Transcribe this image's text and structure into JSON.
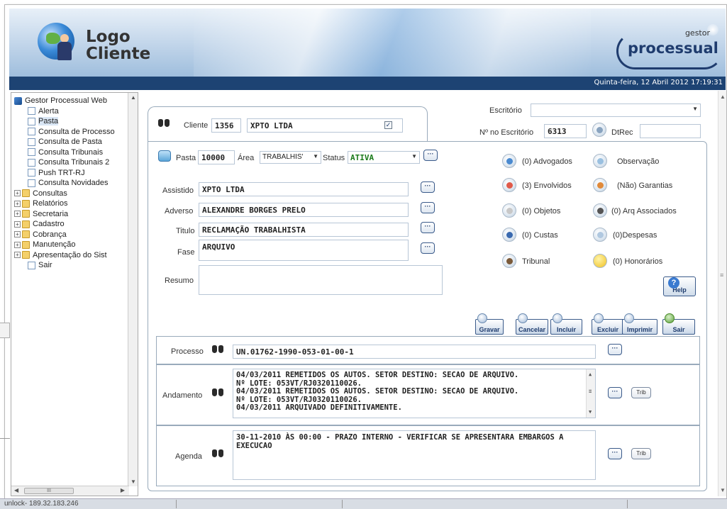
{
  "header": {
    "logo_line1": "Logo",
    "logo_line2": "Cliente",
    "brand_small": "gestor",
    "brand_big": "processual",
    "datetime": "Quinta-feira, 12 Abril 2012 17:19:31"
  },
  "sidebar": {
    "root": "Gestor Processual Web",
    "pages": [
      "Alerta",
      "Pasta",
      "Consulta de Processo",
      "Consulta de Pasta",
      "Consulta Tribunais",
      "Consulta Tribunais 2",
      "Push TRT-RJ",
      "Consulta Novidades"
    ],
    "selected": "Pasta",
    "groups": [
      "Consultas",
      "Relatórios",
      "Secretaria",
      "Cadastro",
      "Cobrança",
      "Manutenção",
      "Apresentação do Sist"
    ],
    "last": "Sair",
    "hscroll_label": "III"
  },
  "form": {
    "cliente_label": "Cliente",
    "cliente_code": "1356",
    "cliente_name": "XPTO LTDA",
    "cliente_check": "✓",
    "escritorio_label": "Escritório",
    "escritorio_value": "",
    "no_escritorio_label": "Nº no Escritório",
    "no_escritorio_value": "6313",
    "dtrec_label": "DtRec",
    "dtrec_value": "",
    "pasta_label": "Pasta",
    "pasta_value": "10000",
    "area_label": "Área",
    "area_value": "TRABALHIS'",
    "status_label": "Status",
    "status_value": "ATIVA",
    "assistido_label": "Assistido",
    "assistido_value": "XPTO LTDA",
    "adverso_label": "Adverso",
    "adverso_value": "ALEXANDRE BORGES PRELO",
    "titulo_label": "Titulo",
    "titulo_value": "RECLAMAÇÃO TRABALHISTA",
    "fase_label": "Fase",
    "fase_value": "ARQUIVO",
    "resumo_label": "Resumo",
    "resumo_value": "",
    "dots": "···"
  },
  "options": {
    "advogados": "(0) Advogados",
    "observacao": "Observação",
    "envolvidos": "(3) Envolvidos",
    "garantias": "(Não) Garantias",
    "objetos": "(0) Objetos",
    "arq_associados": "(0) Arq Associados",
    "custas": "(0) Custas",
    "despesas": "(0)Despesas",
    "tribunal": "Tribunal",
    "honorarios": "(0) Honorários",
    "help": "Help"
  },
  "actions": {
    "gravar": "Gravar",
    "cancelar": "Cancelar",
    "incluir": "Incluir",
    "excluir": "Excluir",
    "imprimir": "Imprimir",
    "sair": "Sair"
  },
  "processo": {
    "label": "Processo",
    "value": "UN.01762-1990-053-01-00-1"
  },
  "andamento": {
    "label": "Andamento",
    "lines": [
      "04/03/2011    REMETIDOS OS AUTOS. SETOR DESTINO: SECAO DE ARQUIVO.",
      "Nº LOTE: 053VT/RJ0320110026.",
      "04/03/2011    REMETIDOS OS AUTOS. SETOR DESTINO: SECAO DE ARQUIVO.",
      "Nº LOTE: 053VT/RJ0320110026.",
      "04/03/2011    ARQUIVADO DEFINITIVAMENTE."
    ],
    "trib": "Trib"
  },
  "agenda": {
    "label": "Agenda",
    "text": "30-11-2010 ÀS 00:00 - PRAZO INTERNO - VERIFICAR SE APRESENTARA EMBARGOS A EXECUCAO",
    "trib": "Trib"
  },
  "statusbar": {
    "text": "unlock- 189.32.183.246"
  },
  "colors": {
    "header_bar": "#1d4373",
    "status_green": "#1a7a1a",
    "brand_blue": "#1f3c6e"
  }
}
